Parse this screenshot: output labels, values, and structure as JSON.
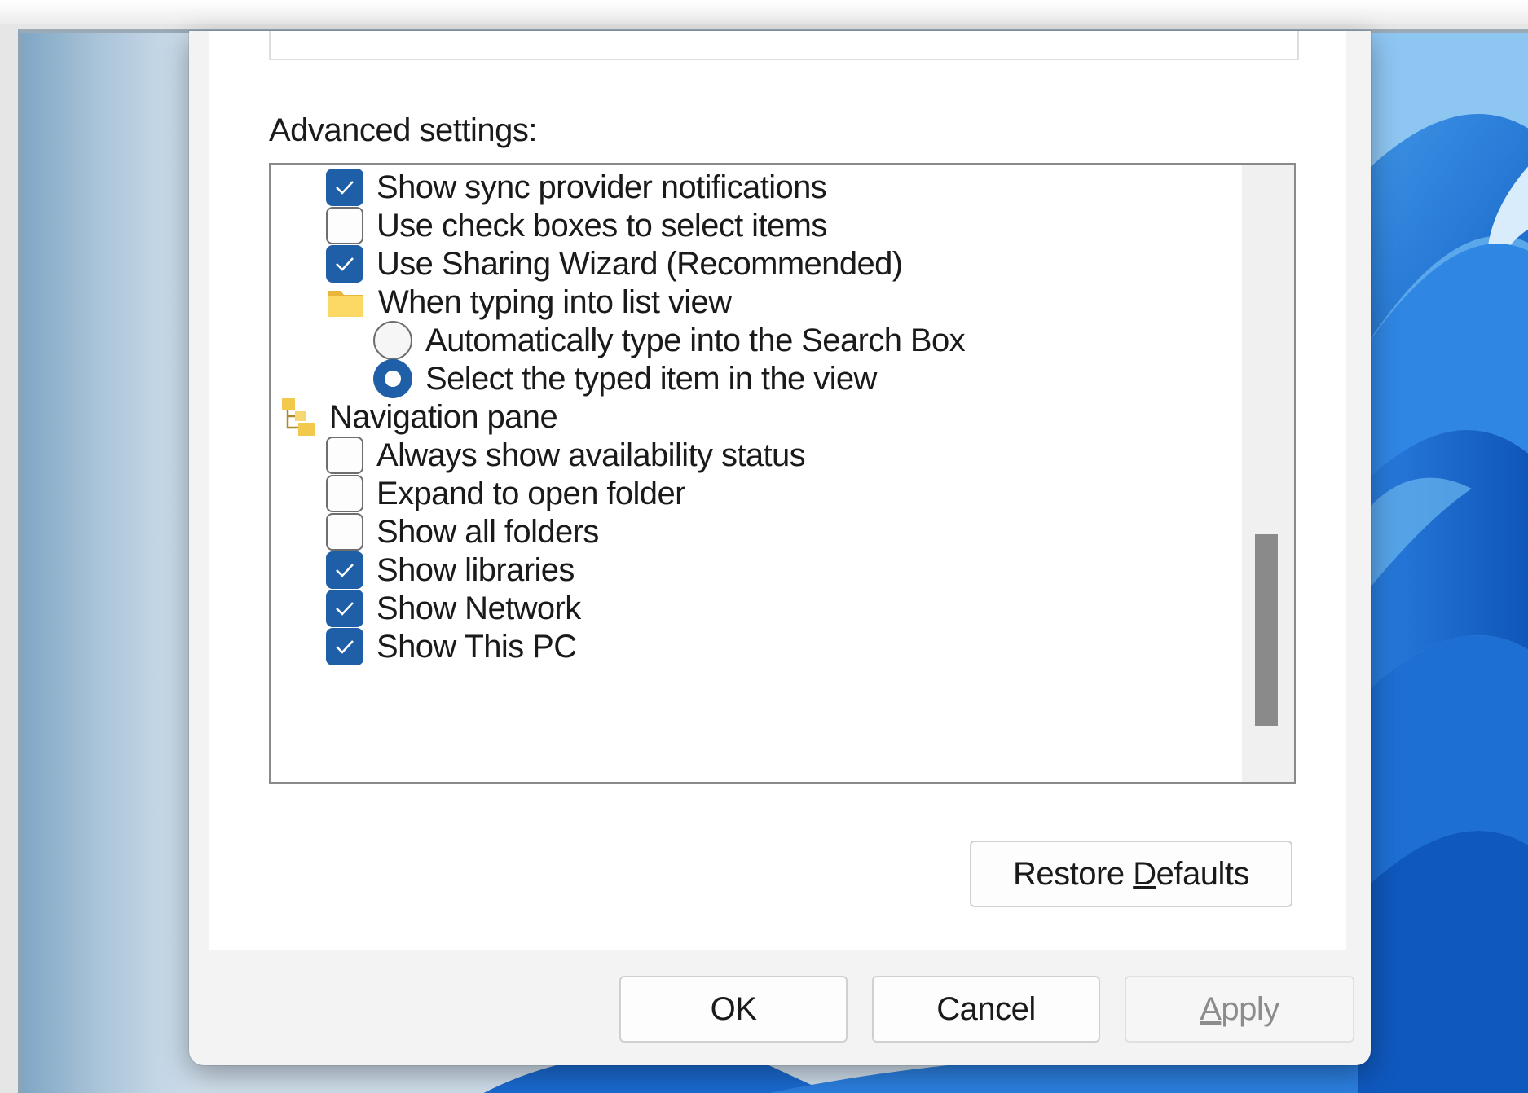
{
  "advanced_settings_label": "Advanced settings:",
  "settings": [
    {
      "kind": "checkbox",
      "label": "Show sync provider notifications",
      "checked": true
    },
    {
      "kind": "checkbox",
      "label": "Use check boxes to select items",
      "checked": false
    },
    {
      "kind": "checkbox",
      "label": "Use Sharing Wizard (Recommended)",
      "checked": true
    },
    {
      "kind": "folder",
      "label": "When typing into list view",
      "icon": "folder-icon"
    },
    {
      "kind": "radio",
      "label": "Automatically type into the Search Box",
      "checked": false
    },
    {
      "kind": "radio",
      "label": "Select the typed item in the view",
      "checked": true
    },
    {
      "kind": "group",
      "label": "Navigation pane",
      "icon": "navigation-pane-icon"
    },
    {
      "kind": "checkbox",
      "label": "Always show availability status",
      "checked": false
    },
    {
      "kind": "checkbox",
      "label": "Expand to open folder",
      "checked": false
    },
    {
      "kind": "checkbox",
      "label": "Show all folders",
      "checked": false
    },
    {
      "kind": "checkbox",
      "label": "Show libraries",
      "checked": true
    },
    {
      "kind": "checkbox",
      "label": "Show Network",
      "checked": true
    },
    {
      "kind": "checkbox",
      "label": "Show This PC",
      "checked": true
    }
  ],
  "buttons": {
    "restore_defaults_pre": "Restore ",
    "restore_defaults_key": "D",
    "restore_defaults_post": "efaults",
    "ok": "OK",
    "cancel": "Cancel",
    "apply_key": "A",
    "apply_post": "pply"
  },
  "colors": {
    "accent": "#1e5fa8",
    "dialog_background": "#f3f3f3",
    "panel_background": "#ffffff",
    "disabled_text": "#8c8c8c"
  }
}
